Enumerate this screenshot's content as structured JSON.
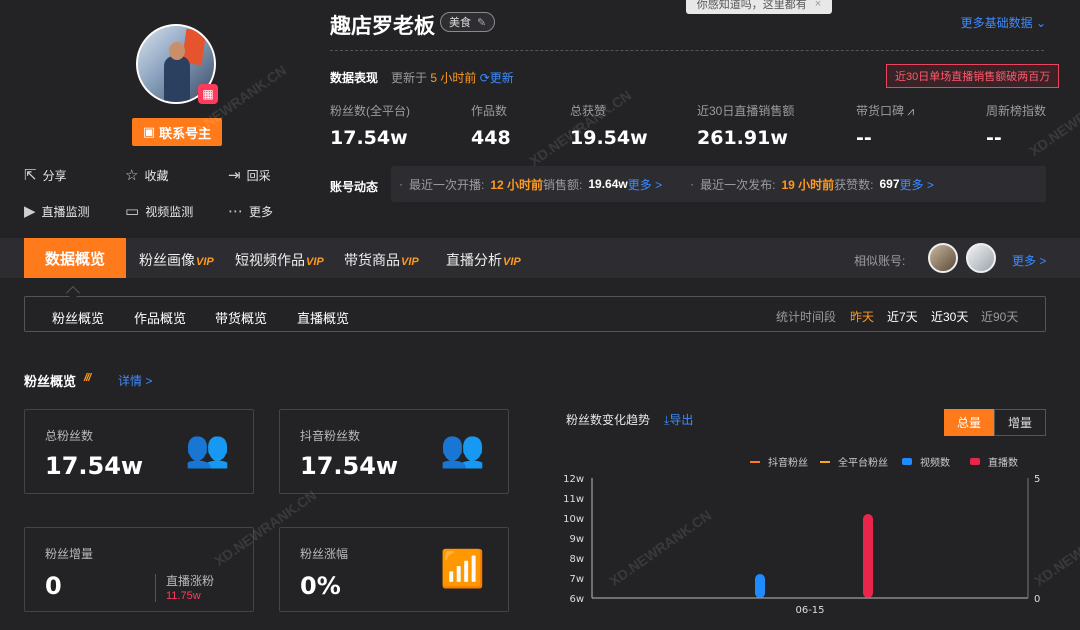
{
  "profile": {
    "name": "趣店罗老板",
    "tag": "美食",
    "contact_label": "联系号主",
    "actions": [
      "分享",
      "收藏",
      "回采",
      "直播监测",
      "视频监测",
      "更多"
    ]
  },
  "tooltip": "你感知道吗，这里都有",
  "more_basic": "更多基础数据",
  "performance": {
    "label": "数据表现",
    "update_prefix": "更新于",
    "update_time": "5 小时前",
    "refresh": "更新",
    "badge": "近30日单场直播销售额破两百万"
  },
  "stats": [
    {
      "label": "粉丝数(全平台)",
      "value": "17.54w"
    },
    {
      "label": "作品数",
      "value": "448"
    },
    {
      "label": "总获赞",
      "value": "19.54w"
    },
    {
      "label": "近30日直播销售额",
      "value": "261.91w"
    },
    {
      "label": "带货口碑",
      "value": "--"
    },
    {
      "label": "周新榜指数",
      "value": "--"
    }
  ],
  "dynamics": {
    "label": "账号动态",
    "live_prefix": "最近一次开播:",
    "live_time": "12 小时前",
    "sales_label": "销售额:",
    "sales_value": "19.64w",
    "more1": "更多 >",
    "post_prefix": "最近一次发布:",
    "post_time": "19 小时前",
    "likes_label": "获赞数:",
    "likes_value": "697",
    "more2": "更多 >"
  },
  "nav": {
    "active": "数据概览",
    "items": [
      {
        "label": "粉丝画像",
        "vip": "VIP"
      },
      {
        "label": "短视频作品",
        "vip": "VIP"
      },
      {
        "label": "带货商品",
        "vip": "VIP"
      },
      {
        "label": "直播分析",
        "vip": "VIP"
      }
    ],
    "similar_label": "相似账号:",
    "more": "更多 >"
  },
  "subtabs": [
    "粉丝概览",
    "作品概览",
    "带货概览",
    "直播概览"
  ],
  "period": {
    "label": "统计时间段",
    "options": [
      "昨天",
      "近7天",
      "近30天",
      "近90天"
    ],
    "selected": "昨天"
  },
  "section": {
    "title": "粉丝概览",
    "detail": "详情 >"
  },
  "cards": [
    {
      "label": "总粉丝数",
      "value": "17.54w"
    },
    {
      "label": "抖音粉丝数",
      "value": "17.54w"
    },
    {
      "label": "粉丝增量",
      "value": "0",
      "sub_label": "直播涨粉",
      "sub_value": "11.75w"
    },
    {
      "label": "粉丝涨幅",
      "value": "0%"
    }
  ],
  "chart_panel": {
    "title": "粉丝数变化趋势",
    "export": "导出",
    "toggle_on": "总量",
    "toggle_off": "增量"
  },
  "chart_data": {
    "type": "bar",
    "categories": [
      "06-15"
    ],
    "legend": [
      {
        "name": "抖音粉丝",
        "color": "#ff7a1a",
        "kind": "line"
      },
      {
        "name": "全平台粉丝",
        "color": "#f5a623",
        "kind": "line"
      },
      {
        "name": "视频数",
        "color": "#1f8bff",
        "kind": "bar"
      },
      {
        "name": "直播数",
        "color": "#e8264c",
        "kind": "bar"
      }
    ],
    "y_left_ticks": [
      "12w",
      "11w",
      "10w",
      "9w",
      "8w",
      "7w",
      "6w"
    ],
    "y_left_range": [
      6,
      12
    ],
    "y_right_ticks": [
      "5",
      "0"
    ],
    "y_right_range": [
      0,
      5
    ],
    "series": [
      {
        "name": "视频数",
        "values": [
          1
        ]
      },
      {
        "name": "直播数",
        "values": [
          3.5
        ]
      }
    ],
    "legend_position": "top-right"
  },
  "watermark": "XD.NEWRANK.CN"
}
